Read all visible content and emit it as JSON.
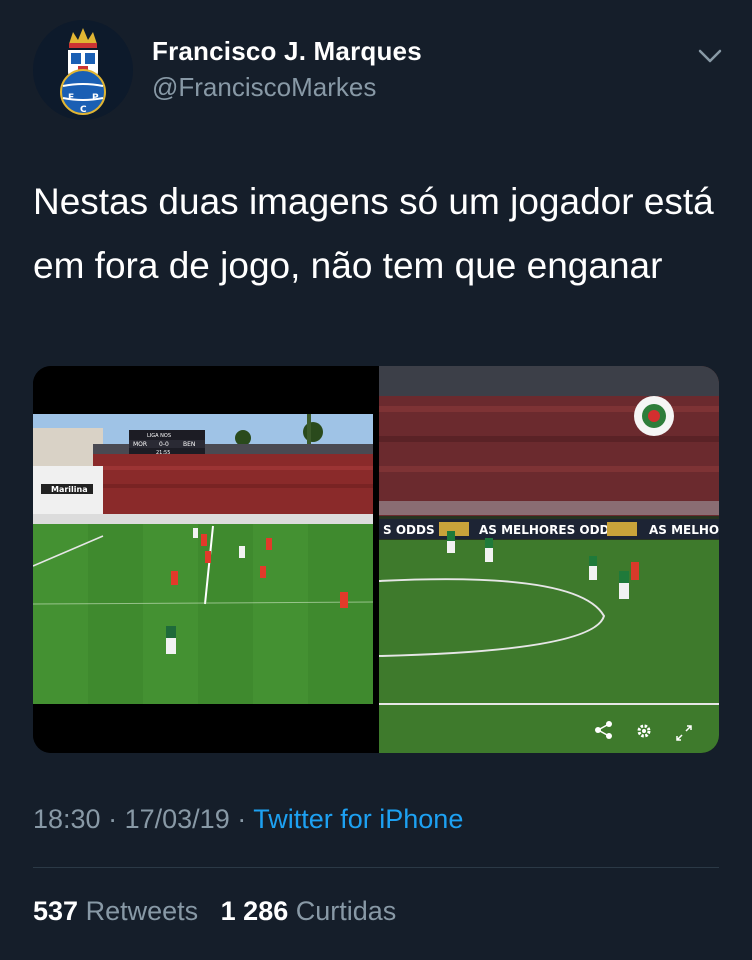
{
  "author": {
    "name": "Francisco J. Marques",
    "handle": "@FranciscoMarkes",
    "avatar_icon": "fc-porto-crest-icon"
  },
  "tweet": {
    "text": "Nestas duas imagens só um jogador está em fora de jogo, não tem que enganar"
  },
  "media": {
    "left": {
      "scoreboard_league": "LIGA NOS",
      "home_team": "MOR",
      "score": "0-0",
      "away_team": "BEN",
      "clock": "21:55",
      "sponsor": "Marilina"
    },
    "right": {
      "banner_texts": [
        "S ODDS",
        "AS MELHORES ODDS",
        "AS MELHO"
      ],
      "share_icon": "share-icon",
      "settings_icon": "gear-icon",
      "expand_icon": "expand-icon"
    }
  },
  "meta": {
    "time": "18:30",
    "sep1": "·",
    "date": "17/03/19",
    "sep2": "·",
    "source": "Twitter for iPhone"
  },
  "stats": {
    "retweets_count": "537",
    "retweets_label": "Retweets",
    "likes_count": "1 286",
    "likes_label": "Curtidas"
  },
  "colors": {
    "background": "#151e2a",
    "secondary_text": "#8899a6",
    "link": "#1da1f2",
    "pitch_green": "#3f8a2e",
    "divider": "#2b3946"
  }
}
